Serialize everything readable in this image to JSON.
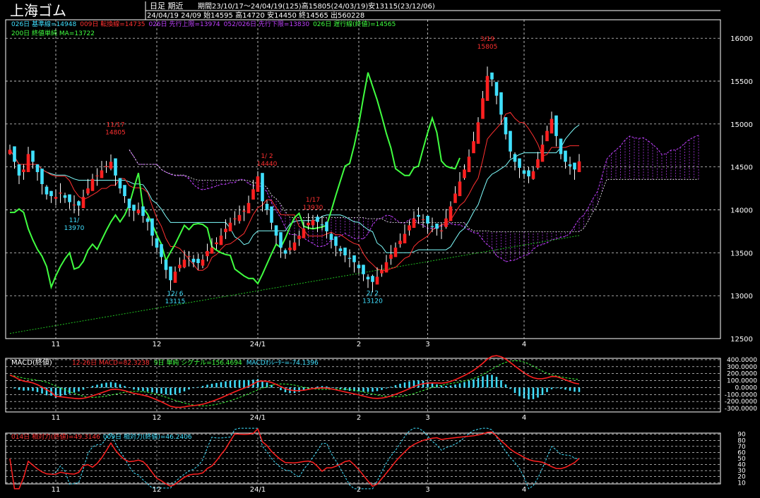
{
  "header": {
    "symbol": "上海ゴム",
    "period_label": "日足 期近",
    "range_info": "期間23/10/17～24/04/19(125)高15805(24/03/19)安13115(23/12/06)",
    "last_bar_info": "24/04/19 24/09 始14595 高14720 安14450 終14565 出560228"
  },
  "colors": {
    "background": "#000000",
    "frame": "#ffffff",
    "up_candle": "#ff2020",
    "down_candle": "#40e0ff",
    "base_line": "#80ffff",
    "conversion_line": "#ff3030",
    "span_a": "#c040ff",
    "span_b": "#ffffff",
    "lagging_span": "#40ff40",
    "ma200": "#20c020",
    "macd_line": "#ff2020",
    "signal_line": "#40ff40",
    "macd_hist": "#40e0ff",
    "rsi14": "#ff2020",
    "rsi9": "#40e0ff"
  },
  "price_panel": {
    "legend_line1": [
      {
        "text": "026日 基準線=14948",
        "color": "#40e0ff"
      },
      {
        "text": "009日 転換線=14735",
        "color": "#ff3030"
      },
      {
        "text": "026日 先行上限=13974",
        "color": "#c040ff"
      },
      {
        "text": "052/026日 先行下限=13830",
        "color": "#c040ff"
      },
      {
        "text": "026日 遅行線(終値)=14565",
        "color": "#40ff40"
      }
    ],
    "legend_line2": [
      {
        "text": "200日 終値単純 MA=13722",
        "color": "#40ff40"
      }
    ],
    "annotations": [
      {
        "date": "11/17",
        "value": "14805",
        "x_bar": 23,
        "price": 14805,
        "pos": "above",
        "color": "#ff3030"
      },
      {
        "date": "1/ 2",
        "value": "14440",
        "x_bar": 56,
        "price": 14440,
        "pos": "above",
        "color": "#ff3030"
      },
      {
        "date": "1/17",
        "value": "13930",
        "x_bar": 66,
        "price": 13930,
        "pos": "above",
        "color": "#ff3030"
      },
      {
        "date": "3/19",
        "value": "15805",
        "x_bar": 104,
        "price": 15805,
        "pos": "above",
        "color": "#ff3030"
      },
      {
        "date": "11/",
        "value": "13970",
        "x_bar": 14,
        "price": 13970,
        "pos": "below",
        "color": "#40e0ff"
      },
      {
        "date": "12/ 6",
        "value": "13115",
        "x_bar": 36,
        "price": 13115,
        "pos": "below",
        "color": "#40e0ff"
      },
      {
        "date": "2/ 2",
        "value": "13120",
        "x_bar": 79,
        "price": 13120,
        "pos": "below",
        "color": "#40e0ff"
      }
    ]
  },
  "macd_panel": {
    "title": "MACD(終値)",
    "legend": [
      {
        "text": "12-26日 MACD=82.3238",
        "color": "#ff3030"
      },
      {
        "text": "9日 単純 シグナル=156.4694",
        "color": "#40ff40"
      },
      {
        "text": "MACDｵｼﾚｰﾀｰ=-74.1396",
        "color": "#40e0ff"
      }
    ],
    "y_ticks": [
      "400.0000",
      "300.0000",
      "200.0000",
      "100.0000",
      "0.0000",
      "-100.0000",
      "-200.0000",
      "-300.0000"
    ]
  },
  "rsi_panel": {
    "legend": [
      {
        "text": "014日 相対力(終値)=49.3146",
        "color": "#ff3030"
      },
      {
        "text": "009日 相対力(終値)=46.2406",
        "color": "#40e0ff"
      }
    ],
    "y_ticks": [
      "90",
      "80",
      "70",
      "60",
      "50",
      "40",
      "30",
      "20",
      "10"
    ]
  },
  "x_axis": {
    "labels": [
      {
        "text": "11",
        "bar": 10
      },
      {
        "text": "12",
        "bar": 32
      },
      {
        "text": "24/1",
        "bar": 54
      },
      {
        "text": "2",
        "bar": 76
      },
      {
        "text": "3",
        "bar": 91
      },
      {
        "text": "4",
        "bar": 112
      }
    ]
  },
  "chart_data": {
    "type": "candlestick",
    "title": "上海ゴム",
    "total_bars": 125,
    "ylim": [
      12500,
      16100
    ],
    "y_ticks": [
      16000,
      15500,
      15000,
      14500,
      14000,
      13500,
      13000,
      12500
    ],
    "closes": [
      14700,
      14560,
      14400,
      14470,
      14650,
      14560,
      14440,
      14300,
      14180,
      14160,
      14150,
      14200,
      14140,
      14090,
      14060,
      14050,
      14150,
      14250,
      14360,
      14400,
      14460,
      14510,
      14560,
      14400,
      14250,
      14160,
      14020,
      13990,
      14000,
      13930,
      13860,
      13700,
      13560,
      13450,
      13300,
      13180,
      13280,
      13360,
      13420,
      13460,
      13390,
      13380,
      13420,
      13520,
      13560,
      13620,
      13700,
      13780,
      13850,
      13900,
      13940,
      13990,
      14080,
      14240,
      14390,
      14100,
      14000,
      13850,
      13700,
      13560,
      13490,
      13560,
      13620,
      13700,
      13780,
      13850,
      13880,
      13860,
      13820,
      13750,
      13650,
      13580,
      13520,
      13470,
      13430,
      13390,
      13320,
      13250,
      13190,
      13160,
      13220,
      13300,
      13390,
      13480,
      13560,
      13640,
      13720,
      13820,
      13900,
      13920,
      13890,
      13840,
      13800,
      13780,
      13760,
      13900,
      14040,
      14190,
      14330,
      14470,
      14620,
      14800,
      15020,
      15300,
      15560,
      15520,
      15330,
      15110,
      14880,
      14680,
      14560,
      14490,
      14420,
      14390,
      14450,
      14590,
      14760,
      14920,
      15060,
      14860,
      14650,
      14560,
      14510,
      14470,
      14565
    ]
  }
}
